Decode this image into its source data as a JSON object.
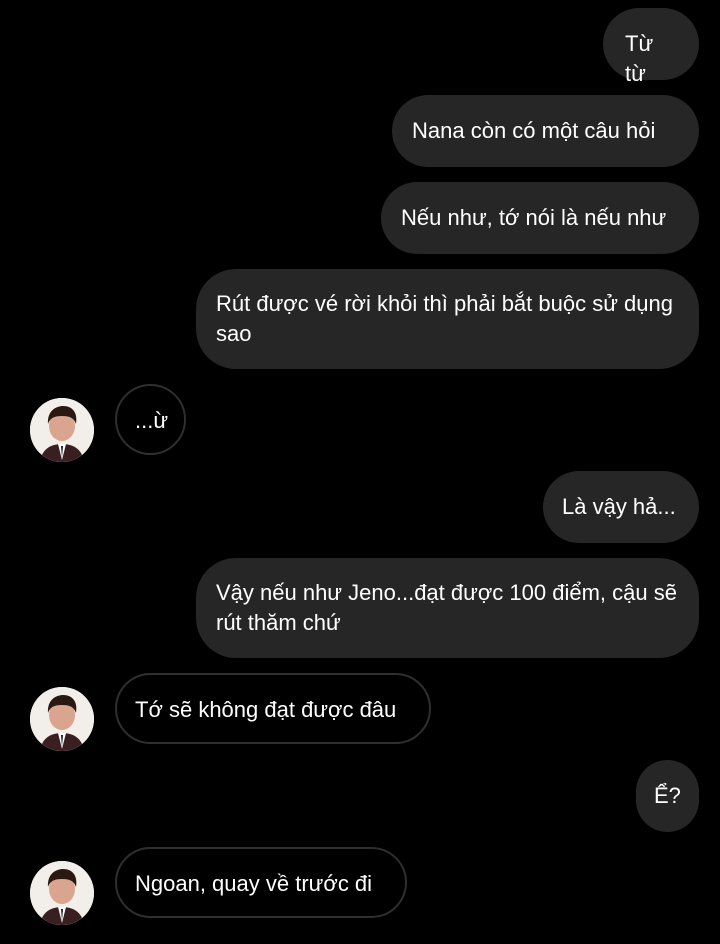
{
  "messages": [
    {
      "side": "out",
      "text": "Từ từ"
    },
    {
      "side": "out",
      "text": "Nana còn có một câu hỏi"
    },
    {
      "side": "out",
      "text": "Nếu như, tớ nói là nếu như"
    },
    {
      "side": "out",
      "text": "Rút được vé rời khỏi thì phải bắt buộc sử dụng sao"
    },
    {
      "side": "in",
      "text": "...ừ"
    },
    {
      "side": "out",
      "text": "Là vậy hả..."
    },
    {
      "side": "out",
      "text": "Vậy nếu như Jeno...đạt được 100 điểm, cậu sẽ rút thăm chứ"
    },
    {
      "side": "in",
      "text": "Tớ sẽ không đạt được đâu"
    },
    {
      "side": "out",
      "text": "Ể?"
    },
    {
      "side": "in",
      "text": "Ngoan, quay về trước đi"
    }
  ],
  "contact": {
    "avatar_icon": "user-avatar-photo"
  },
  "colors": {
    "background": "#000000",
    "outgoing_bubble": "#262626",
    "incoming_border": "#2f2f2f",
    "text": "#ffffff"
  }
}
